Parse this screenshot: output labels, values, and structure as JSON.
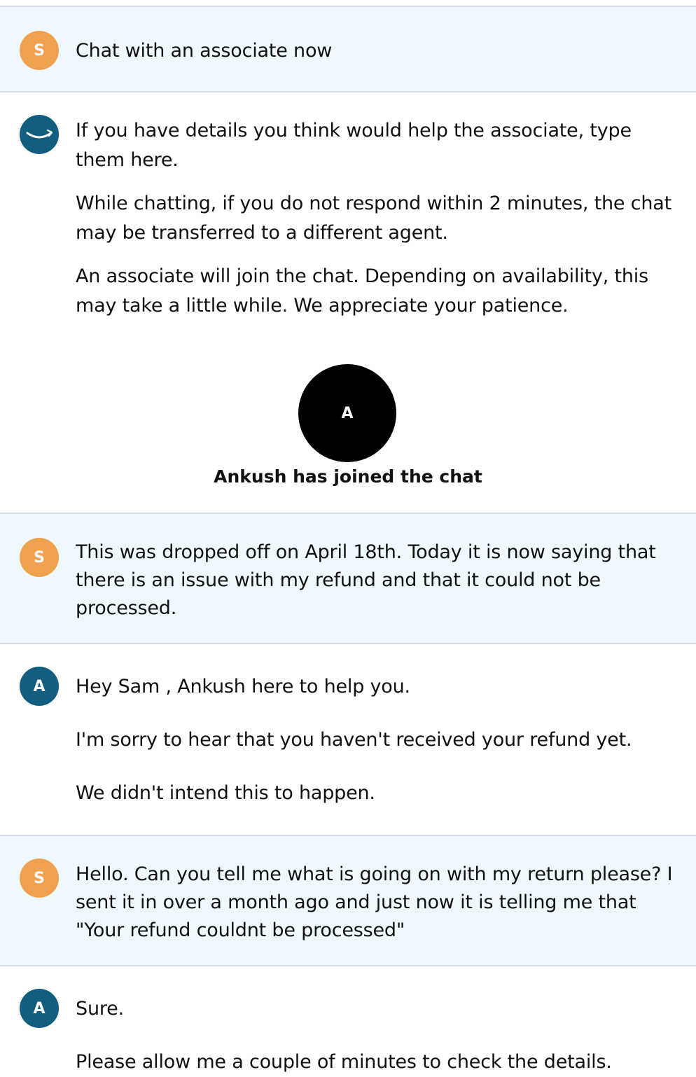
{
  "messages": {
    "m1": {
      "avatar": "S",
      "text": "Chat with an associate now"
    },
    "m2": {
      "avatar_icon": "amazon-smile-icon",
      "p1": "If you have details you think would help the associate, type them here.",
      "p2": "While chatting, if you do not respond within 2 minutes, the chat may be transferred to a different agent.",
      "p3": "An associate will join the chat. Depending on availability, this may take a little while. We appreciate your patience."
    },
    "join": {
      "avatar": "A",
      "text": "Ankush has joined the chat"
    },
    "m3": {
      "avatar": "S",
      "text": "This was dropped off on April 18th. Today it is now saying that there is an issue with my refund and that it could not be processed."
    },
    "m4": {
      "avatar": "A",
      "p1": "Hey Sam , Ankush here to help you.",
      "p2": "I'm sorry to hear that you haven't received your refund yet.",
      "p3": "We didn't intend this to happen."
    },
    "m5": {
      "avatar": "S",
      "text": "Hello. Can you tell me what is going on with my return please? I sent it in over a month ago and just now it is telling me that \"Your refund couldnt be processed\""
    },
    "m6": {
      "avatar": "A",
      "p1": "Sure.",
      "p2": "Please allow me a couple of minutes to check the details."
    }
  },
  "colors": {
    "customer_bg": "#eff9fd",
    "customer_avatar": "#f0a150",
    "agent_avatar": "#135e7f",
    "divider": "#d5dbdb"
  }
}
